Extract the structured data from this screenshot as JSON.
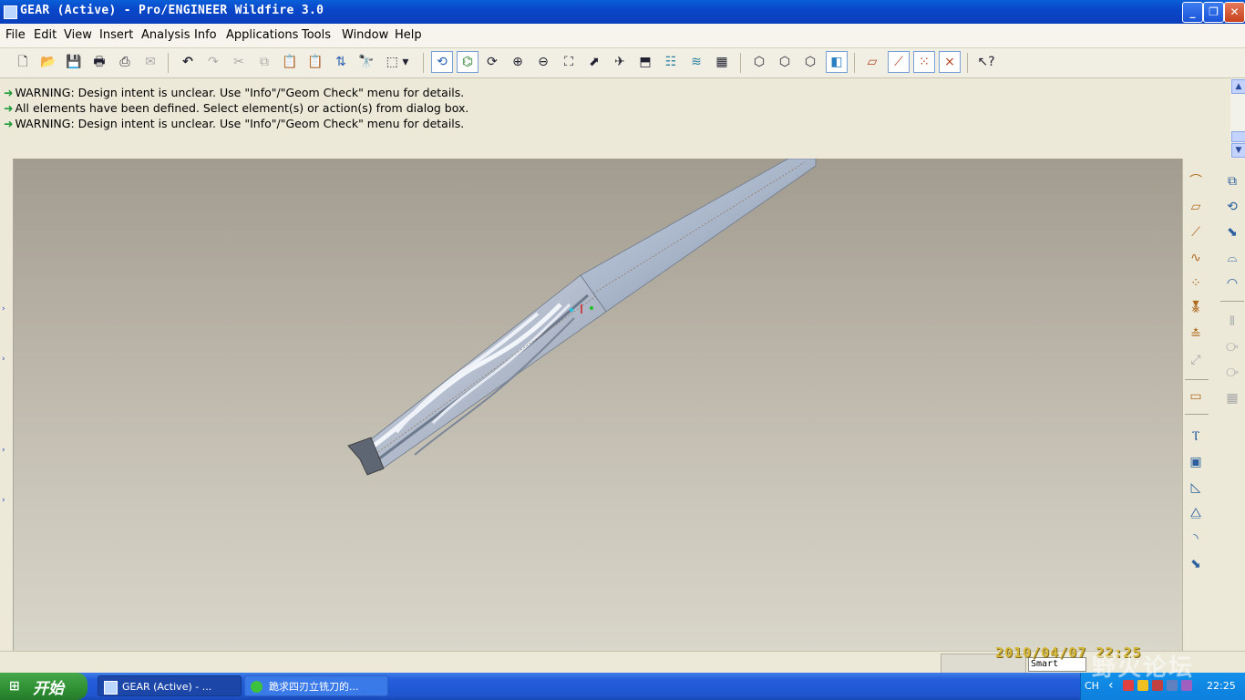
{
  "window": {
    "title": "GEAR (Active) - Pro/ENGINEER Wildfire 3.0",
    "minimize": "_",
    "restore": "❐",
    "close": "✕"
  },
  "menu": [
    "File",
    "Edit",
    "View",
    "Insert",
    "Analysis",
    "Info",
    "Applications",
    "Tools",
    "Window",
    "Help"
  ],
  "messages": [
    "WARNING: Design intent is unclear.  Use \"Info\"/\"Geom Check\" menu for details.",
    "All elements have been defined. Select element(s) or action(s) from dialog box.",
    "WARNING: Design intent is unclear.  Use \"Info\"/\"Geom Check\" menu for details."
  ],
  "status": {
    "filter_value": "Smart",
    "datestamp": "2010/04/07  22:25"
  },
  "taskbar": {
    "start_label": "开始",
    "tasks": [
      "GEAR (Active) - ...",
      "跪求四刃立铣刀的..."
    ],
    "language": "CH",
    "clock": "22:25"
  },
  "watermark": "野火论坛",
  "icons": {
    "toolbar": [
      "new-file-icon",
      "open-file-icon",
      "save-icon",
      "print-icon",
      "print-preview-icon",
      "email-icon",
      "undo-icon",
      "redo-icon",
      "cut-icon",
      "copy-icon",
      "paste-icon",
      "paste-special-icon",
      "regenerate-icon",
      "find-icon",
      "select-box-icon",
      "repaint-icon",
      "spin-center-icon",
      "orient-icon",
      "zoom-in-icon",
      "zoom-out-icon",
      "refit-icon",
      "reorient-icon",
      "saved-views-icon",
      "layers-icon",
      "view-manager-icon",
      "model-display-icon",
      "wireframe-icon",
      "hidden-line-icon",
      "no-hidden-icon",
      "shading-icon",
      "datum-plane-display-icon",
      "datum-axis-display-icon",
      "datum-point-display-icon",
      "csys-display-icon",
      "context-help-icon"
    ]
  }
}
